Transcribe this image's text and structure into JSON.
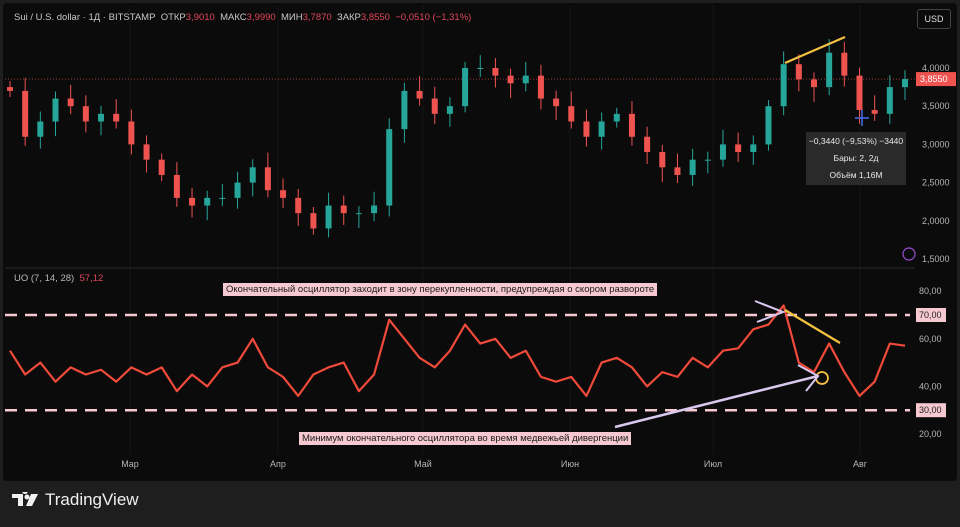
{
  "header": {
    "symbol": "Sui / U.S. dollar · 1Д · BITSTAMP",
    "open_label": "ОТКР",
    "open": "3,9010",
    "high_label": "МАКС",
    "high": "3,9990",
    "low_label": "МИН",
    "low": "3,7870",
    "close_label": "ЗАКР",
    "close": "3,8550",
    "change": "−0,0510 (−1,31%)"
  },
  "currency_button": "USD",
  "indicator": {
    "name": "UO (7, 14, 28)",
    "value": "57,12"
  },
  "tooltip": {
    "line1": "−0,3440 (−9,53%) −3440",
    "line2": "Бары: 2, 2д",
    "line3": "Объём 1,16M"
  },
  "annotations": {
    "top": "Окончательный осциллятор заходит в зону перекупленности, предупреждая о скором развороте",
    "bottom": "Минимум окончательного осциллятора во время медвежьей дивергенции"
  },
  "brand": "TradingView",
  "colors": {
    "up": "#26a69a",
    "down": "#ef5350",
    "uo_line": "#f04a3a",
    "level_line": "#f6c9d0",
    "trend": "#f5c242",
    "arrow": "#d9c8f0"
  },
  "chart_data": [
    {
      "type": "candlestick",
      "ylim": [
        1.5,
        4.5
      ],
      "price_ticks": [
        "4,0000",
        "3,5000",
        "3,0000",
        "2,5000",
        "2,0000",
        "1,5000"
      ],
      "last_price": "3,8550",
      "close": [
        3.7,
        3.1,
        3.3,
        3.6,
        3.5,
        3.3,
        3.4,
        3.3,
        3.0,
        2.8,
        2.6,
        2.3,
        2.2,
        2.3,
        2.3,
        2.5,
        2.7,
        2.4,
        2.3,
        2.1,
        1.9,
        2.2,
        2.1,
        2.1,
        2.2,
        3.2,
        3.7,
        3.6,
        3.4,
        3.5,
        4.0,
        4.0,
        3.9,
        3.8,
        3.9,
        3.6,
        3.5,
        3.3,
        3.1,
        3.3,
        3.4,
        3.1,
        2.9,
        2.7,
        2.6,
        2.8,
        2.8,
        3.0,
        2.9,
        3.0,
        3.5,
        4.05,
        3.85,
        3.75,
        4.2,
        3.9,
        3.45,
        3.4,
        3.75,
        3.855
      ]
    },
    {
      "type": "line",
      "name": "UO (7, 14, 28)",
      "ylim": [
        15,
        85
      ],
      "ticks": [
        "80,00",
        "60,00",
        "40,00",
        "20,00"
      ],
      "levels": [
        "70,00",
        "30,00"
      ],
      "values": [
        55,
        45,
        50,
        42,
        48,
        45,
        47,
        42,
        48,
        45,
        48,
        38,
        45,
        40,
        48,
        50,
        60,
        48,
        44,
        36,
        45,
        48,
        50,
        38,
        45,
        68,
        60,
        52,
        48,
        55,
        66,
        58,
        60,
        52,
        55,
        44,
        42,
        44,
        36,
        50,
        52,
        48,
        40,
        46,
        44,
        52,
        48,
        55,
        56,
        64,
        66,
        74,
        50,
        46,
        58,
        46,
        36,
        42,
        58,
        57.12
      ]
    }
  ],
  "x_axis": [
    "Мар",
    "Апр",
    "Май",
    "Июн",
    "Июл",
    "Авг"
  ]
}
